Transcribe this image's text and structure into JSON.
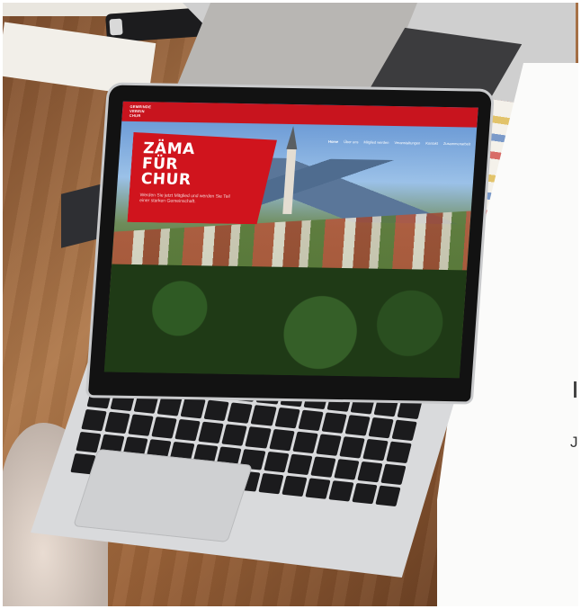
{
  "website": {
    "logo_lines": [
      "GEMEINDE",
      "VEREIN",
      "CHUR"
    ],
    "nav_items": [
      "Home",
      "Über uns",
      "Mitglied werden",
      "Veranstaltungen",
      "Kontakt",
      "Zusammenarbeit"
    ],
    "hero": {
      "title_line1": "ZÄMA",
      "title_line2": "FÜR",
      "title_line3": "CHUR",
      "subtitle": "Werden Sie jetzt Mitglied und werden Sie Teil einer starken Gemeinschaft."
    },
    "accent_color": "#d0141d"
  },
  "side_card": {
    "partial_text": "Je"
  }
}
